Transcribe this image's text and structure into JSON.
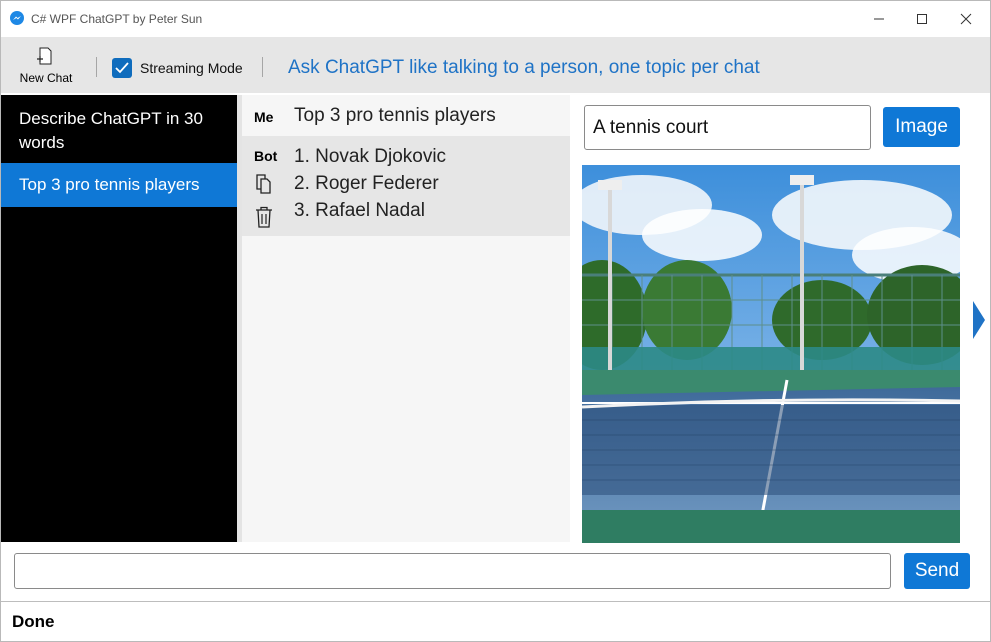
{
  "window": {
    "title": "C# WPF ChatGPT by Peter Sun"
  },
  "toolbar": {
    "new_chat_label": "New Chat",
    "streaming_label": "Streaming Mode",
    "streaming_checked": true,
    "tagline": "Ask ChatGPT like talking to a person, one topic per chat"
  },
  "sidebar": {
    "items": [
      {
        "label": "Describe ChatGPT in 30 words",
        "selected": false
      },
      {
        "label": "Top 3 pro tennis players",
        "selected": true
      }
    ]
  },
  "conversation": {
    "me_label": "Me",
    "me_text": "Top 3 pro tennis players",
    "bot_label": "Bot",
    "bot_lines": [
      "1. Novak Djokovic",
      "2. Roger Federer",
      "3. Rafael Nadal"
    ]
  },
  "image_panel": {
    "prompt_value": "A tennis court",
    "image_button_label": "Image"
  },
  "input": {
    "value": "",
    "send_label": "Send"
  },
  "status": {
    "text": "Done"
  },
  "colors": {
    "accent": "#0f78d6",
    "tagline": "#1f73c6",
    "sidebar_bg": "#000000"
  }
}
